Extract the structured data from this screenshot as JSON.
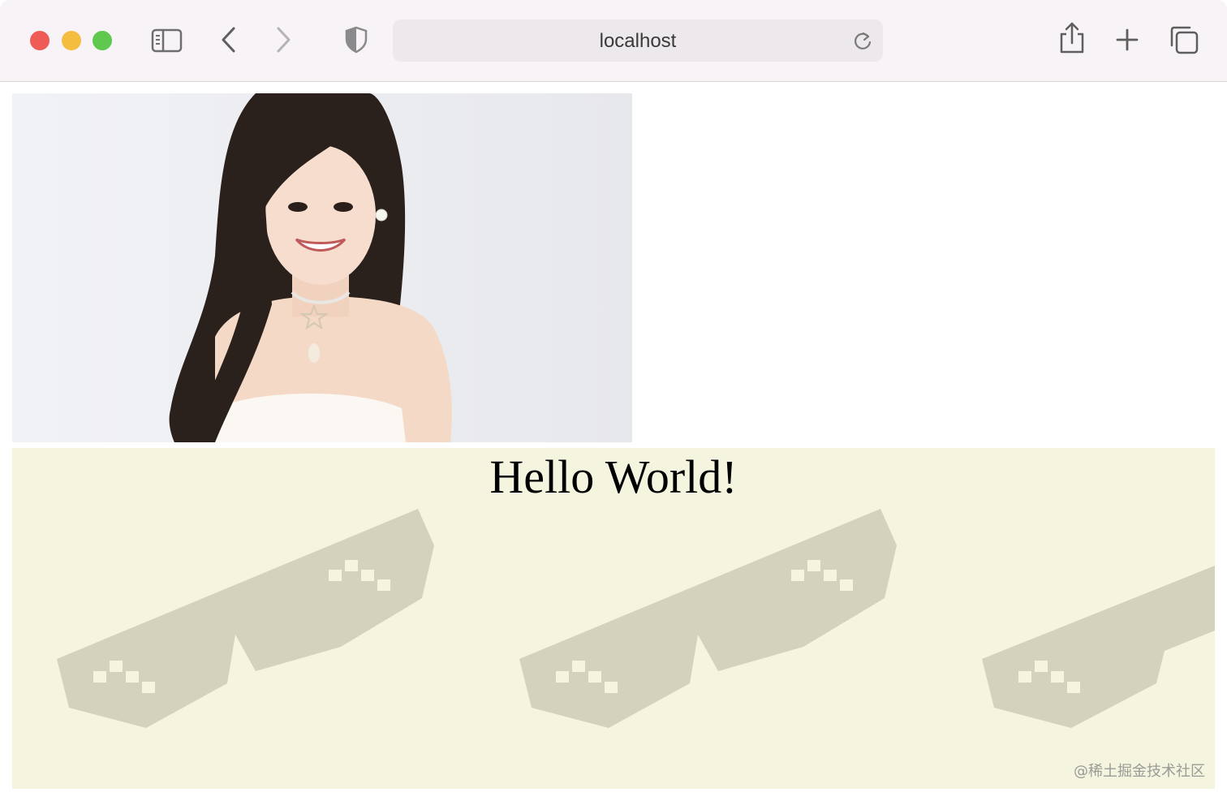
{
  "browser": {
    "address": "localhost",
    "icons": {
      "sidebar": "sidebar-icon",
      "back": "chevron-left-icon",
      "forward": "chevron-right-icon",
      "privacy": "shield-icon",
      "reload": "reload-icon",
      "share": "share-icon",
      "new_tab": "plus-icon",
      "tabs": "tabs-overview-icon"
    },
    "colors": {
      "close": "#ee5c55",
      "minimize": "#f4bd40",
      "zoom": "#5ec84f"
    }
  },
  "page": {
    "heading": "Hello World!",
    "watermark": "@稀土掘金技术社区",
    "banner_pattern": "pixel-sunglasses",
    "banner_color": "#f4f4df"
  }
}
